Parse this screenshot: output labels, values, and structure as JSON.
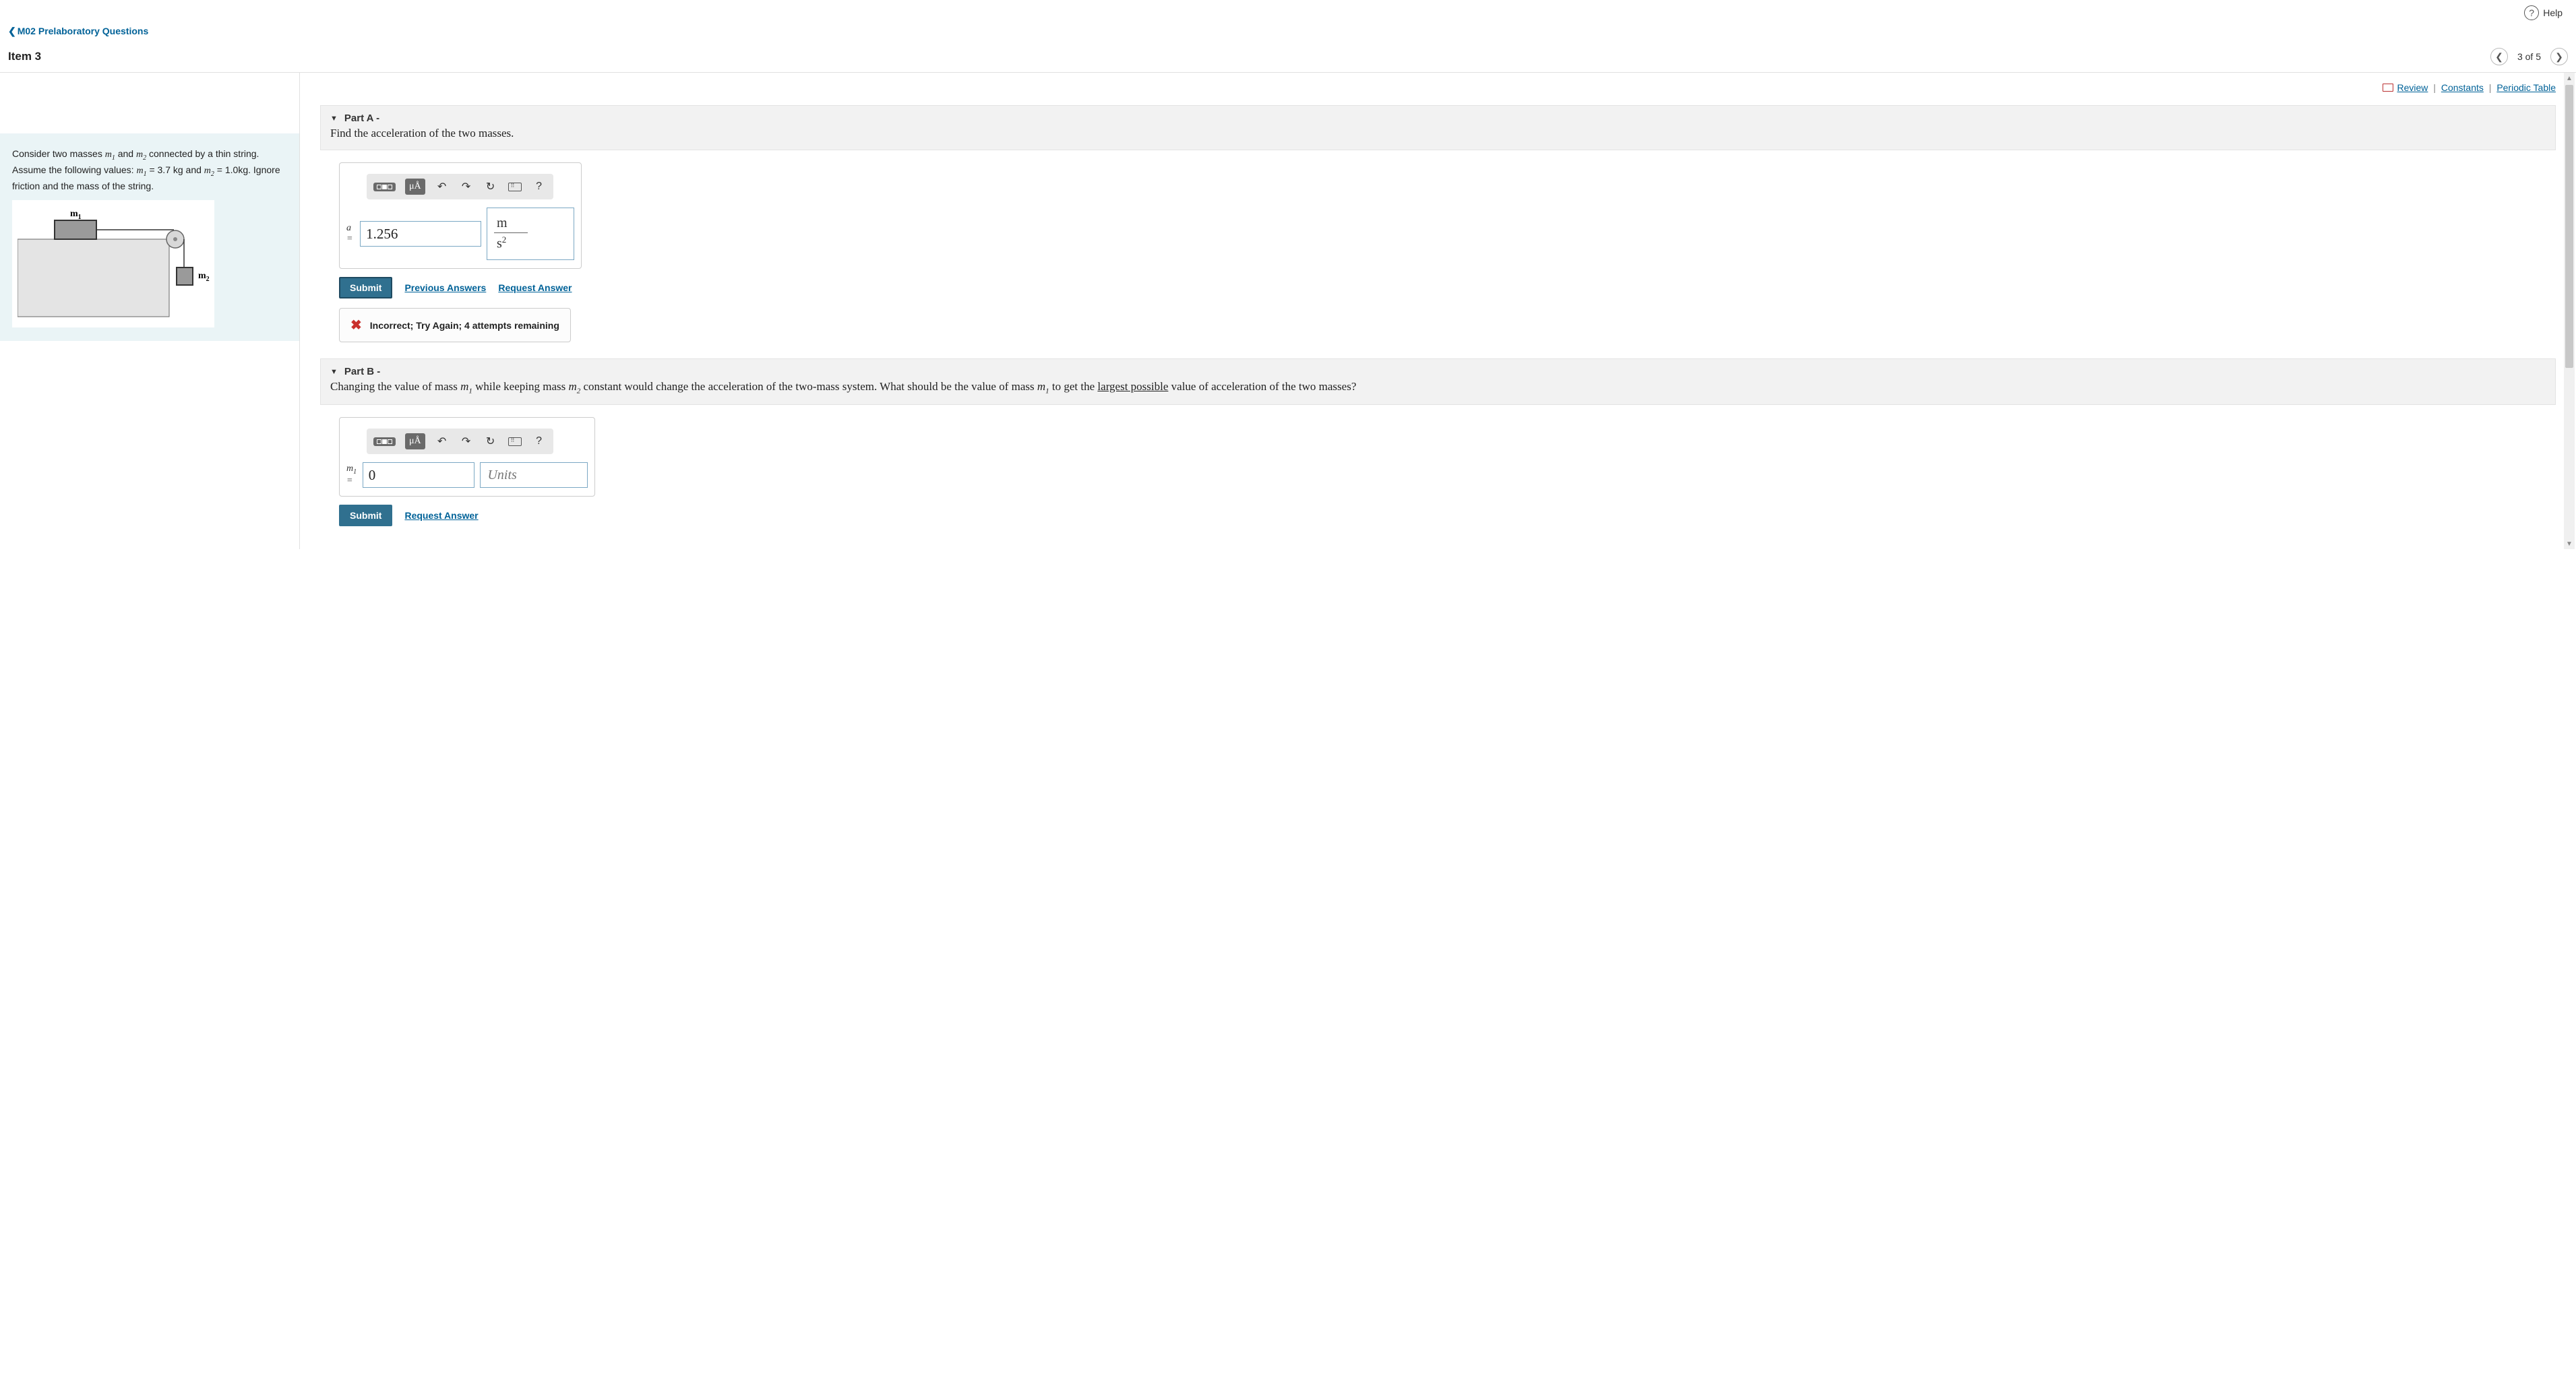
{
  "header": {
    "help_label": "Help",
    "breadcrumb": "M02 Prelaboratory Questions",
    "item_title": "Item 3",
    "pager": "3 of 5"
  },
  "resources": {
    "review": "Review",
    "constants": "Constants",
    "periodic": "Periodic Table"
  },
  "problem": {
    "text_pre": "Consider two masses ",
    "m1": "m",
    "m1_sub": "1",
    "text_and": " and ",
    "m2": "m",
    "m2_sub": "2",
    "text_mid": " connected by a thin string. Assume the following values: ",
    "m1eq": "m",
    "m1eq_sub": "1",
    "val1": " = 3.7 kg and ",
    "m2eq": "m",
    "m2eq_sub": "2",
    "val2": " = 1.0kg. Ignore friction and the mass of the string.",
    "fig_label_m1": "m",
    "fig_label_m1_sub": "1",
    "fig_label_m2": "m",
    "fig_label_m2_sub": "2"
  },
  "partA": {
    "label": "Part A -",
    "prompt": "Find the acceleration of the two masses.",
    "var_label": "a =",
    "value": "1.256",
    "unit_num": "m",
    "unit_den_base": "s",
    "unit_den_exp": "2",
    "submit": "Submit",
    "prev_answers": "Previous Answers",
    "request": "Request Answer",
    "feedback": "Incorrect; Try Again; 4 attempts remaining"
  },
  "partB": {
    "label": "Part B -",
    "prompt_1": "Changing the value of mass ",
    "m1": "m",
    "m1_sub": "1",
    "prompt_2": " while keeping mass ",
    "m2": "m",
    "m2_sub": "2",
    "prompt_3": " constant would change the acceleration of the two-mass system.  What should be the value of mass ",
    "m1b": "m",
    "m1b_sub": "1",
    "prompt_4": " to get the ",
    "underline": "largest possible",
    "prompt_5": " value of acceleration of the two masses?",
    "var_label_base": "m",
    "var_label_sub": "1",
    "var_label_eq": " =",
    "value": "0",
    "unit_placeholder": "Units",
    "submit": "Submit",
    "request": "Request Answer"
  },
  "toolbar": {
    "mu_label": "μÅ",
    "help": "?"
  }
}
